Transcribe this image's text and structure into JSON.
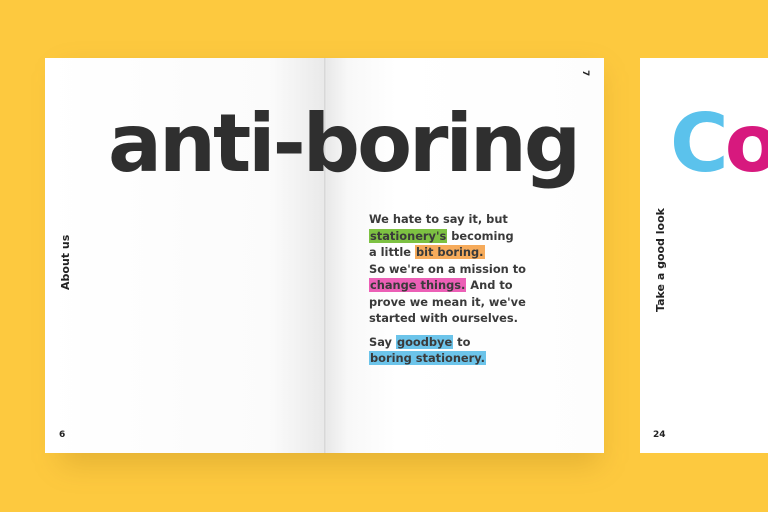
{
  "spread": {
    "headline": "anti-boring",
    "left_page": {
      "side_label": "About us",
      "page_number": "6"
    },
    "right_page": {
      "page_number": "7",
      "paragraph1": {
        "line1": "We hate to say it, but",
        "hl_stationery": "stationery's",
        "t_becoming": " becoming",
        "t_a_little": "a little ",
        "hl_bit_boring": "bit boring.",
        "line4": "So we're on a mission to",
        "hl_change_things": "change things.",
        "t_and_to": " And to",
        "line6": "prove we mean it, we've",
        "line7": "started with ourselves."
      },
      "paragraph2": {
        "t_say": "Say ",
        "hl_goodbye": "goodbye",
        "t_to": " to",
        "hl_boring_stationery": "boring stationery."
      }
    }
  },
  "next_page": {
    "headline_partial_1": "C",
    "headline_partial_2": "o",
    "side_label": "Take a good look",
    "page_number": "24"
  },
  "colors": {
    "background": "#fdc93f",
    "highlight_green": "#7dc142",
    "highlight_orange": "#f6ab5b",
    "highlight_pink": "#ec5fb6",
    "highlight_blue": "#6cc4ea",
    "accent_cyan": "#5bc2ec",
    "accent_magenta": "#d7197e"
  }
}
